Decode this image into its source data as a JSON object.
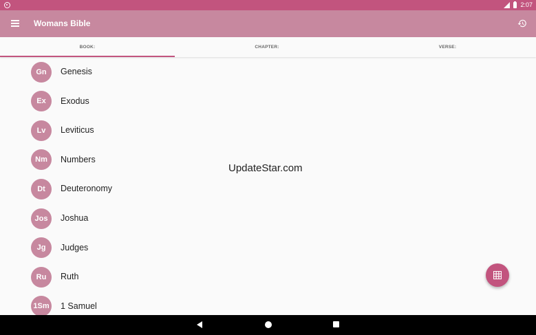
{
  "status_bar": {
    "time": "2:07",
    "icons": [
      "circle-indicator-icon",
      "signal-icon",
      "battery-icon"
    ]
  },
  "app_bar": {
    "title": "Womans Bible",
    "left_icon": "menu-icon",
    "right_icon": "history-icon"
  },
  "tabs": [
    {
      "label": "BOOK:",
      "selected": true
    },
    {
      "label": "CHAPTER:",
      "selected": false
    },
    {
      "label": "VERSE:",
      "selected": false
    }
  ],
  "books": [
    {
      "abbr": "Gn",
      "name": "Genesis"
    },
    {
      "abbr": "Ex",
      "name": "Exodus"
    },
    {
      "abbr": "Lv",
      "name": "Leviticus"
    },
    {
      "abbr": "Nm",
      "name": "Numbers"
    },
    {
      "abbr": "Dt",
      "name": "Deuteronomy"
    },
    {
      "abbr": "Jos",
      "name": "Joshua"
    },
    {
      "abbr": "Jg",
      "name": "Judges"
    },
    {
      "abbr": "Ru",
      "name": "Ruth"
    },
    {
      "abbr": "1Sm",
      "name": "1 Samuel"
    }
  ],
  "watermark": "UpdateStar.com",
  "fab": {
    "icon": "grid-icon"
  },
  "nav_bar": {
    "icons": [
      "back-icon",
      "home-icon",
      "recents-icon"
    ]
  },
  "colors": {
    "status_bar": "#c2547e",
    "app_bar": "#c7889f",
    "accent": "#c2547e",
    "badge": "#c7889f"
  }
}
